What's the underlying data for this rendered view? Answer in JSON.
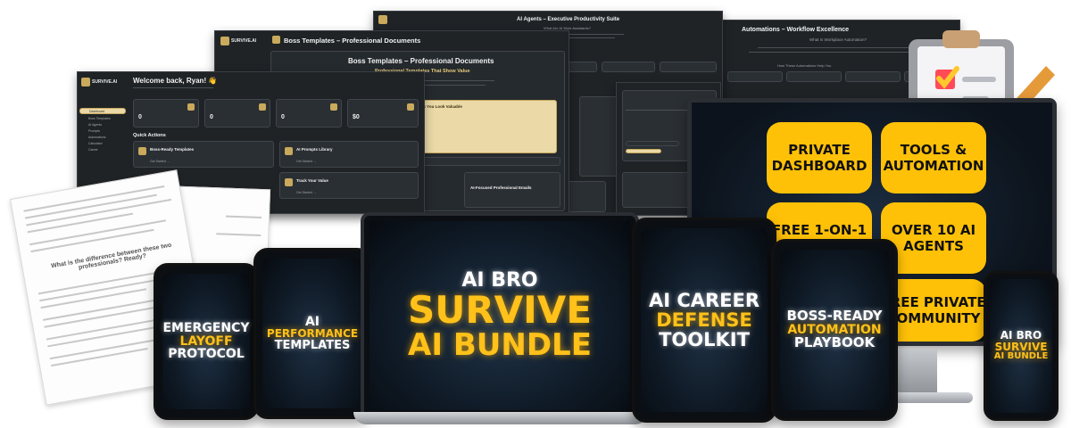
{
  "screens": {
    "automations": {
      "title": "Automations – Workflow Excellence",
      "subtitle": "What Is Workplace Automation?",
      "section": "How These Automations Help You"
    },
    "agents": {
      "title": "AI Agents – Executive Productivity Suite",
      "subtitle": "What Are AI Work Assistants?"
    },
    "templates": {
      "brand": "SURVIVE.AI",
      "title": "Boss Templates – Professional Documents",
      "panel_title": "Boss Templates – Professional Documents",
      "panel_sub": "Professional Templates That Show Value",
      "gold_title": "What Makes You Look Valuable",
      "card_title": "AI-Focused Professional Emails"
    },
    "dashboard": {
      "brand": "SURVIVE.AI",
      "welcome": "Welcome back, Ryan! 👋",
      "sidebar": [
        "Dashboard",
        "Boss Templates",
        "AI Agents",
        "Prompts",
        "Automations",
        "Calculator",
        "Career"
      ],
      "stats": [
        "0",
        "0",
        "0",
        "$0"
      ],
      "quick_actions": "Quick Actions",
      "actions": [
        {
          "title": "Boss-Ready Templates",
          "cta": "Get Started →"
        },
        {
          "title": "AI Prompts Library",
          "cta": "Get Started →"
        },
        {
          "title": "Track Your Value",
          "cta": "Get Started →"
        }
      ]
    }
  },
  "badges": [
    "PRIVATE DASHBOARD",
    "TOOLS & AUTOMATION",
    "FREE 1-ON-1 CALL",
    "OVER 10 AI AGENTS",
    "FREE PRIVATE COMMUNITY"
  ],
  "covers": {
    "laptop": {
      "line1": "AI BRO",
      "line2": "SURVIVE",
      "line3": "AI BUNDLE"
    },
    "tablet_left": {
      "line1": "EMERGENCY",
      "line2": "LAYOFF",
      "line3": "PROTOCOL"
    },
    "tablet_mid": {
      "line1": "AI",
      "line2": "PERFORMANCE",
      "line3": "TEMPLATES"
    },
    "tablet_career": {
      "line1": "AI CAREER",
      "line2": "DEFENSE",
      "line3": "TOOLKIT"
    },
    "tablet_boss": {
      "line1": "BOSS-READY",
      "line2": "AUTOMATION",
      "line3": "PLAYBOOK"
    },
    "phone": {
      "line1": "AI BRO",
      "line2": "SURVIVE",
      "line3": "AI BUNDLE"
    }
  },
  "paper": {
    "heading": "What is the difference between these two professionals? Ready?"
  },
  "colors": {
    "gold": "#ffc107",
    "dark": "#1f2326",
    "glow_gold": "#ffc11a"
  }
}
